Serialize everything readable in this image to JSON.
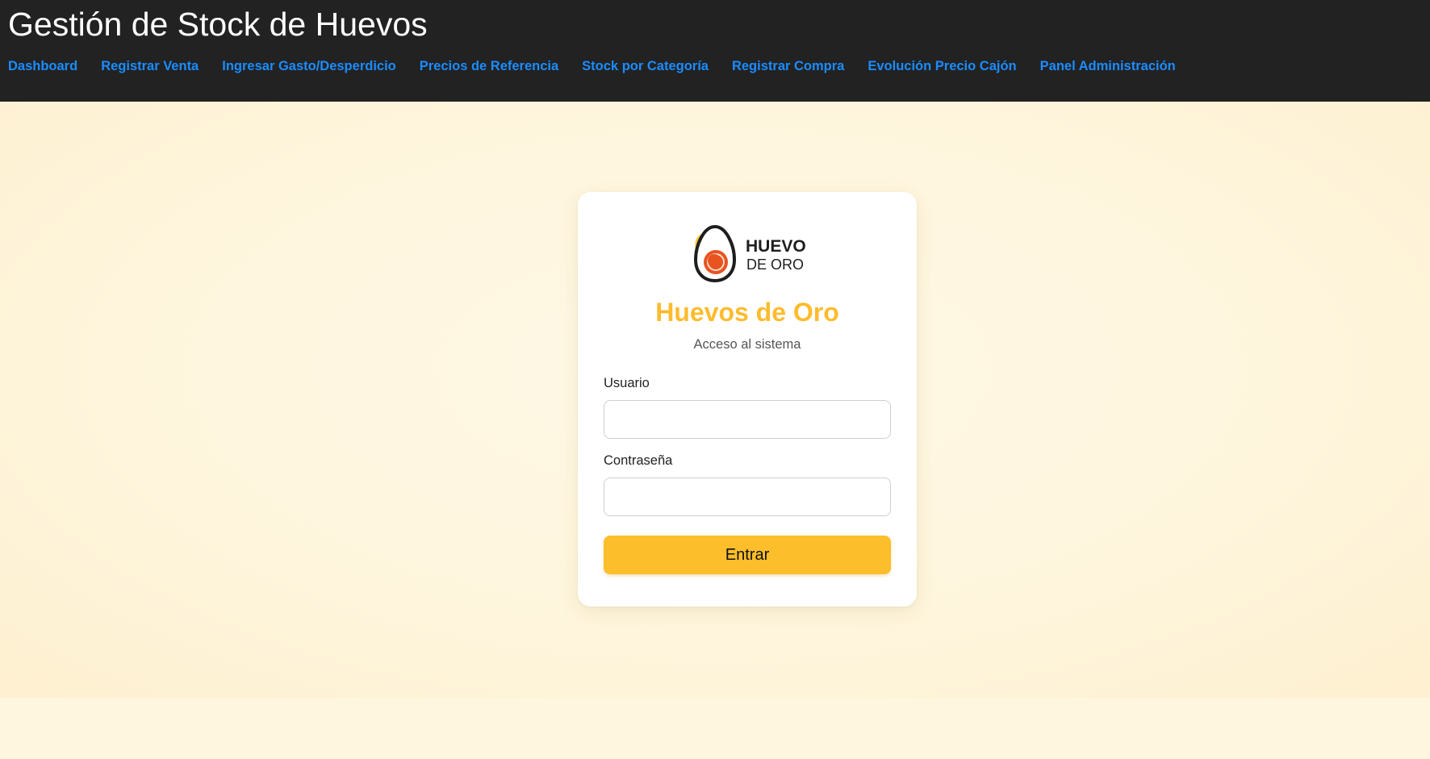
{
  "header": {
    "title": "Gestión de Stock de Huevos",
    "nav": [
      {
        "label": "Dashboard"
      },
      {
        "label": "Registrar Venta"
      },
      {
        "label": "Ingresar Gasto/Desperdicio"
      },
      {
        "label": "Precios de Referencia"
      },
      {
        "label": "Stock por Categoría"
      },
      {
        "label": "Registrar Compra"
      },
      {
        "label": "Evolución Precio Cajón"
      },
      {
        "label": "Panel Administración"
      }
    ]
  },
  "login": {
    "logo": {
      "text_line1": "HUEVO",
      "text_line2": "DE ORO",
      "icon": "egg-logo-icon"
    },
    "title": "Huevos de Oro",
    "subtitle": "Acceso al sistema",
    "username_label": "Usuario",
    "username_value": "",
    "password_label": "Contraseña",
    "password_value": "",
    "submit_label": "Entrar"
  },
  "colors": {
    "topbar_bg": "#222222",
    "nav_link": "#1a8cff",
    "accent": "#fdbb2d",
    "page_bg": "#fef7e3",
    "yolk": "#e8531f"
  }
}
